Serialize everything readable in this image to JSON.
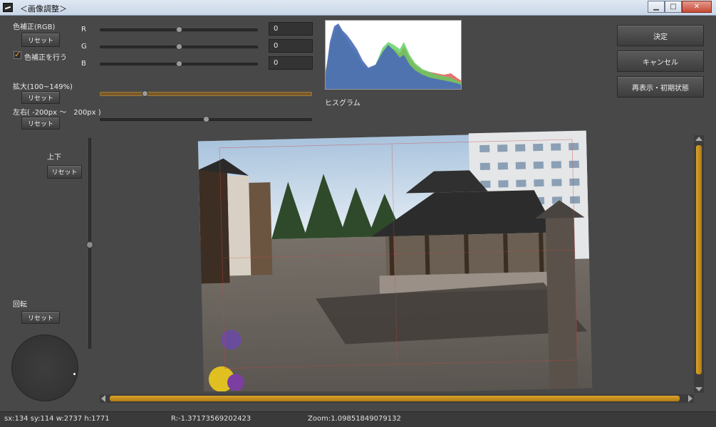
{
  "window": {
    "title": "＜画像調整＞"
  },
  "color_correction": {
    "label": "色補正(RGB)",
    "reset": "リセット",
    "checkbox_label": "色補正を行う",
    "channels": [
      {
        "name": "R",
        "value": "0"
      },
      {
        "name": "G",
        "value": "0"
      },
      {
        "name": "B",
        "value": "0"
      }
    ]
  },
  "zoom_ctrl": {
    "label": "拡大(100~149%)",
    "reset": "リセット"
  },
  "horizontal_ctrl": {
    "label": "左右( -200px ～　200px )",
    "reset": "リセット"
  },
  "vertical_ctrl": {
    "label": "上下",
    "reset": "リセット"
  },
  "rotation_ctrl": {
    "label": "回転",
    "reset": "リセット"
  },
  "histogram": {
    "label": "ヒスグラム"
  },
  "actions": {
    "ok": "決定",
    "cancel": "キャンセル",
    "redisplay": "再表示・初期状態"
  },
  "status": {
    "coords": "sx:134 sy:114 w:2737 h:1771",
    "rotation": "R:-1.37173569202423",
    "zoom": "Zoom:1.09851849079132"
  },
  "slider_levels": {
    "zoom_position": 0.21,
    "horizontal_position": 0.5,
    "vertical_position": 0.5,
    "vscroll_fill": 0.96,
    "hscroll_fill": 0.96
  },
  "colors": {
    "accent": "#d8a32a",
    "panel": "#484848",
    "histogram_blue": "#4a6ab8",
    "histogram_green": "#5ecf5e",
    "histogram_red": "#e05050"
  }
}
